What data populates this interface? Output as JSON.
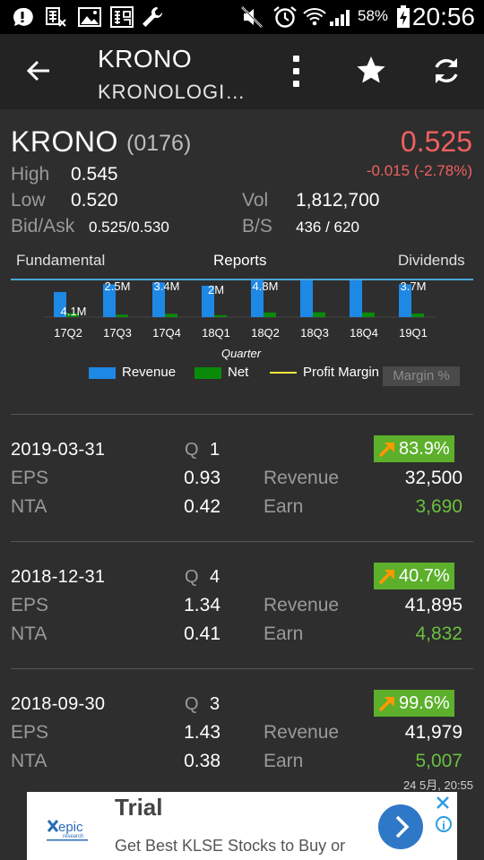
{
  "status_bar": {
    "icons": [
      "notification-bubble-icon",
      "exchange-rate-icon",
      "gallery-icon",
      "calendar-icon",
      "wrench-icon",
      "mute-icon",
      "alarm-icon",
      "wifi-icon",
      "signal-icon",
      "battery-charging-icon"
    ],
    "battery": "58%",
    "time": "20:56"
  },
  "app_bar": {
    "title": "KRONO",
    "subtitle": "KRONOLOGI…",
    "actions": [
      "back-icon",
      "overflow-menu-icon",
      "star-icon",
      "refresh-icon"
    ]
  },
  "quote": {
    "code": "KRONO",
    "stock_no": "(0176)",
    "price": "0.525",
    "change": "-0.015 (-2.78%)",
    "high_label": "High",
    "high": "0.545",
    "low_label": "Low",
    "low": "0.520",
    "bidask_label": "Bid/Ask",
    "bidask": "0.525/0.530",
    "vol_label": "Vol",
    "vol": "1,812,700",
    "bs_label": "B/S",
    "bs": "436 / 620",
    "down_color": "#f06060"
  },
  "tabs": [
    {
      "label": "Fundamental",
      "active": false
    },
    {
      "label": "Reports",
      "active": true
    },
    {
      "label": "Dividends",
      "active": false
    }
  ],
  "chart_data": {
    "type": "bar",
    "categories": [
      "17Q2",
      "17Q3",
      "17Q4",
      "18Q1",
      "18Q2",
      "18Q3",
      "18Q4",
      "19Q1"
    ],
    "xlabel": "Quarter",
    "series": [
      {
        "name": "Revenue",
        "color": "#1e88e5",
        "values": [
          26,
          34,
          36,
          32.5,
          41,
          42,
          42,
          34
        ]
      },
      {
        "name": "Net",
        "color": "#0a8a0a",
        "values": [
          4.1,
          2.5,
          3.4,
          2.0,
          4.8,
          5.0,
          4.8,
          3.7
        ]
      },
      {
        "name": "Profit Margin %",
        "color": "#ffeb3b",
        "values": []
      }
    ],
    "data_labels": [
      "4.1M",
      "2.5M",
      "3.4M",
      "2M",
      "4.8M",
      "",
      "",
      "3.7M"
    ],
    "ylim": [
      0,
      38
    ],
    "legend_ghost": "Margin %"
  },
  "reports": [
    {
      "date": "2019-03-31",
      "q_label": "Q",
      "q": "1",
      "growth": "83.9%",
      "eps_label": "EPS",
      "eps": "0.93",
      "nta_label": "NTA",
      "nta": "0.42",
      "revenue_label": "Revenue",
      "revenue": "32,500",
      "earn_label": "Earn",
      "earn": "3,690"
    },
    {
      "date": "2018-12-31",
      "q_label": "Q",
      "q": "4",
      "growth": "40.7%",
      "eps_label": "EPS",
      "eps": "1.34",
      "nta_label": "NTA",
      "nta": "0.41",
      "revenue_label": "Revenue",
      "revenue": "41,895",
      "earn_label": "Earn",
      "earn": "4,832"
    },
    {
      "date": "2018-09-30",
      "q_label": "Q",
      "q": "3",
      "growth": "99.6%",
      "eps_label": "EPS",
      "eps": "1.43",
      "nta_label": "NTA",
      "nta": "0.38",
      "revenue_label": "Revenue",
      "revenue": "41,979",
      "earn_label": "Earn",
      "earn": "5,007"
    }
  ],
  "updated": "24 5月, 20:55",
  "ad": {
    "logo_text": "epic",
    "logo_sub": "research",
    "title": "Trial",
    "text": "Get Best KLSE Stocks to Buy or"
  }
}
